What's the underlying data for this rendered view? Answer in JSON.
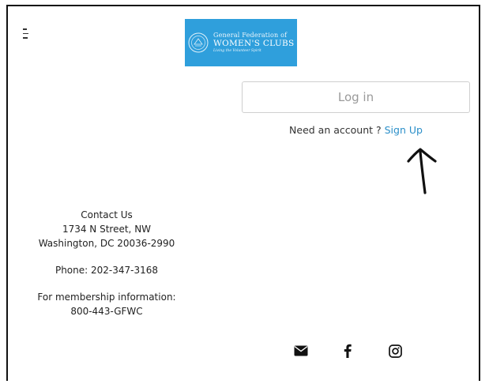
{
  "header": {
    "menu_icon": "menu-icon",
    "logo": {
      "line1": "General Federation of",
      "line2": "WOMEN'S CLUBS",
      "line3": "Living the Volunteer Spirit",
      "color": "#2f9fdc"
    }
  },
  "auth": {
    "login_label": "Log in",
    "need_account_text": "Need an account ? ",
    "signup_label": "Sign Up",
    "link_color": "#2b8fc9"
  },
  "contact": {
    "heading": "Contact Us",
    "street": "1734 N Street, NW",
    "city": "Washington, DC 20036-2990",
    "phone": "Phone: 202-347-3168",
    "membership_label": "For membership information:",
    "membership_phone": "800-443-GFWC"
  },
  "social": {
    "icons": [
      "envelope-icon",
      "facebook-icon",
      "instagram-icon"
    ]
  }
}
